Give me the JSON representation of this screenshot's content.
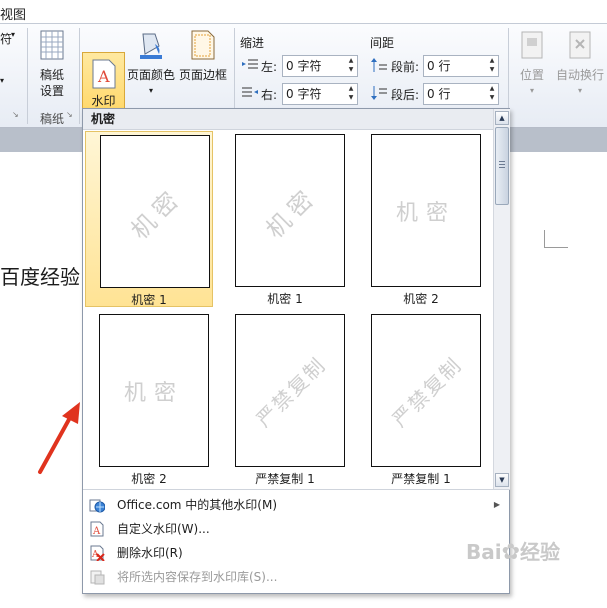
{
  "tabs": {
    "view": "视图"
  },
  "ribbon": {
    "left_partial": "符",
    "manuscript": {
      "label_line1": "稿纸",
      "label_line2": "设置",
      "group": "稿纸"
    },
    "watermark": {
      "label": "水印"
    },
    "page_color": {
      "label": "页面颜色"
    },
    "page_border": {
      "label": "页面边框"
    },
    "indent": {
      "title": "缩进",
      "left_label": "左:",
      "left_value": "0 字符",
      "right_label": "右:",
      "right_value": "0 字符"
    },
    "spacing": {
      "title": "间距",
      "before_label": "段前:",
      "before_value": "0 行",
      "after_label": "段后:",
      "after_value": "0 行"
    },
    "position": {
      "label": "位置"
    },
    "wrap": {
      "label": "自动换行"
    }
  },
  "document": {
    "text": "百度经验"
  },
  "gallery": {
    "header": "机密",
    "tiles": [
      {
        "watermark": "机密",
        "caption": "机密 1",
        "style": "diagonal",
        "selected": true
      },
      {
        "watermark": "机密",
        "caption": "机密 1",
        "style": "diagonal",
        "selected": false
      },
      {
        "watermark": "机密",
        "caption": "机密 2",
        "style": "horizontal",
        "selected": false
      },
      {
        "watermark": "机密",
        "caption": "机密 2",
        "style": "horizontal",
        "selected": false
      },
      {
        "watermark": "严禁复制",
        "caption": "严禁复制 1",
        "style": "diagonal",
        "selected": false
      },
      {
        "watermark": "严禁复制",
        "caption": "严禁复制 1",
        "style": "diagonal",
        "selected": false
      }
    ],
    "menu": [
      {
        "label": "Office.com 中的其他水印(M)",
        "icon": "office-globe-icon",
        "enabled": true,
        "submenu": true
      },
      {
        "label": "自定义水印(W)...",
        "icon": "custom-watermark-icon",
        "enabled": true,
        "submenu": false
      },
      {
        "label": "删除水印(R)",
        "icon": "remove-watermark-icon",
        "enabled": true,
        "submenu": false
      },
      {
        "label": "将所选内容保存到水印库(S)...",
        "icon": "save-to-gallery-icon",
        "enabled": false,
        "submenu": false
      }
    ]
  },
  "watermark_brand": "Baidu经验",
  "colors": {
    "highlight": "#ffd35a",
    "arrow": "#e0331e"
  }
}
